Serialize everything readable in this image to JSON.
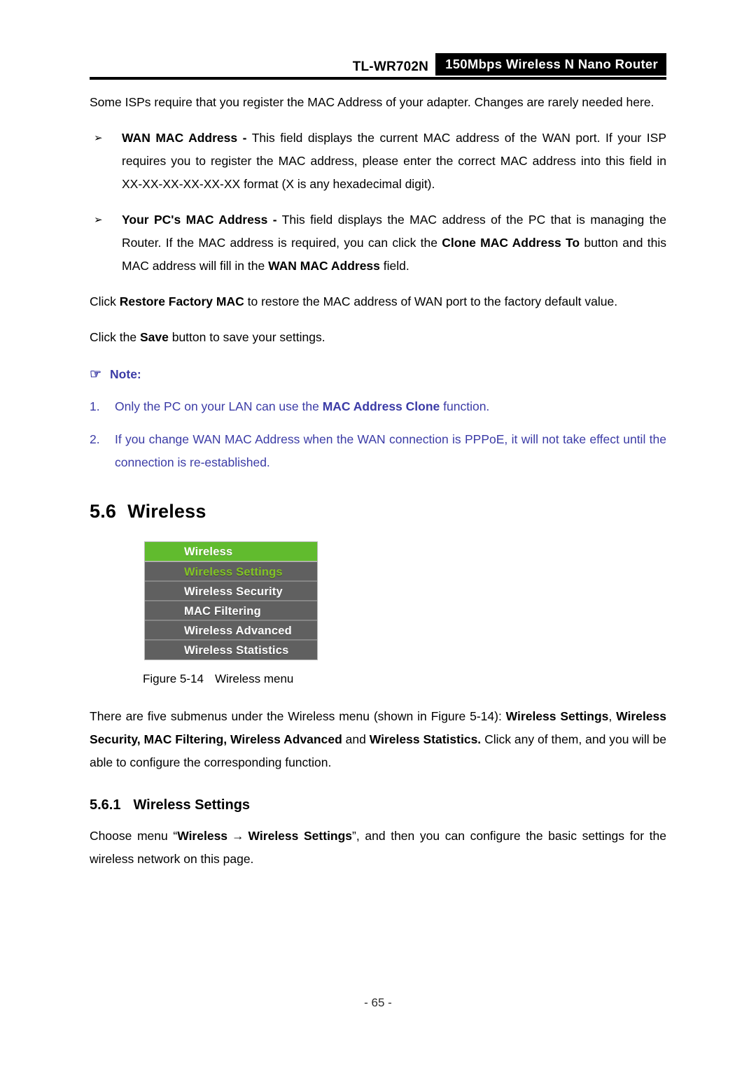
{
  "header": {
    "model": "TL-WR702N",
    "product": "150Mbps  Wireless  N  Nano  Router"
  },
  "intro": {
    "text_1": "Some ISPs require that you register the MAC Address of your adapter. Changes are rarely needed here."
  },
  "bullets": [
    {
      "marker": "➢",
      "term": "WAN MAC Address -",
      "text": " This field displays the current MAC address of the WAN port. If your ISP requires you to register the MAC address, please enter the correct MAC address into this field in XX-XX-XX-XX-XX-XX format (X is any hexadecimal digit)."
    },
    {
      "marker": "➢",
      "term": "Your PC's MAC Address -",
      "text_a": " This field displays the MAC address of the PC that is managing the Router. If the MAC address is required, you can click the ",
      "bold_b": "Clone MAC Address To",
      "text_c": " button and this MAC address will fill in the ",
      "bold_d": "WAN MAC Address",
      "text_e": " field."
    }
  ],
  "paragraphs": {
    "restore_a": "Click ",
    "restore_bold": "Restore Factory MAC",
    "restore_b": " to restore the MAC address of WAN port to the factory default value.",
    "save_a": "Click the ",
    "save_bold": "Save",
    "save_b": " button to save your settings."
  },
  "note": {
    "icon": "☞",
    "title": "Note:",
    "color": "#3b3ba6",
    "items": [
      {
        "num": "1.",
        "text_a": "Only the PC on your LAN can use the ",
        "bold_b": "MAC Address Clone",
        "text_c": " function."
      },
      {
        "num": "2.",
        "text_a": "If you change WAN MAC Address when the WAN connection is PPPoE, it will not take effect until the connection is re-established.",
        "bold_b": "",
        "text_c": ""
      }
    ]
  },
  "section": {
    "number": "5.6",
    "title": "Wireless"
  },
  "wireless_menu": {
    "header_label": "Wireless",
    "header_bg": "#61bb2e",
    "item_bg": "#606060",
    "active_color": "#82c523",
    "items": [
      {
        "label": "Wireless Settings",
        "active": true
      },
      {
        "label": "Wireless Security",
        "active": false
      },
      {
        "label": "MAC Filtering",
        "active": false
      },
      {
        "label": "Wireless Advanced",
        "active": false
      },
      {
        "label": "Wireless Statistics",
        "active": false
      }
    ]
  },
  "figure": {
    "number": "Figure 5-14",
    "caption": "Wireless menu"
  },
  "submenu_paragraph": {
    "text_a": "There are five submenus under the Wireless menu (shown in Figure 5-14): ",
    "bold_b": "Wireless Settings",
    "text_c": ", ",
    "bold_d": "Wireless Security, MAC Filtering, Wireless Advanced",
    "text_e": " and ",
    "bold_f": "Wireless Statistics.",
    "text_g": " Click any of them, and you will be able to configure the corresponding function."
  },
  "subsection": {
    "number": "5.6.1",
    "title": "Wireless Settings"
  },
  "choose_paragraph": {
    "text_a": "Choose menu “",
    "bold_b": "Wireless",
    "arrow": "→",
    "bold_c": "Wireless Settings",
    "text_d": "”, and then you can configure the basic settings for the wireless network on this page."
  },
  "footer": {
    "page_number": "- 65 -"
  }
}
